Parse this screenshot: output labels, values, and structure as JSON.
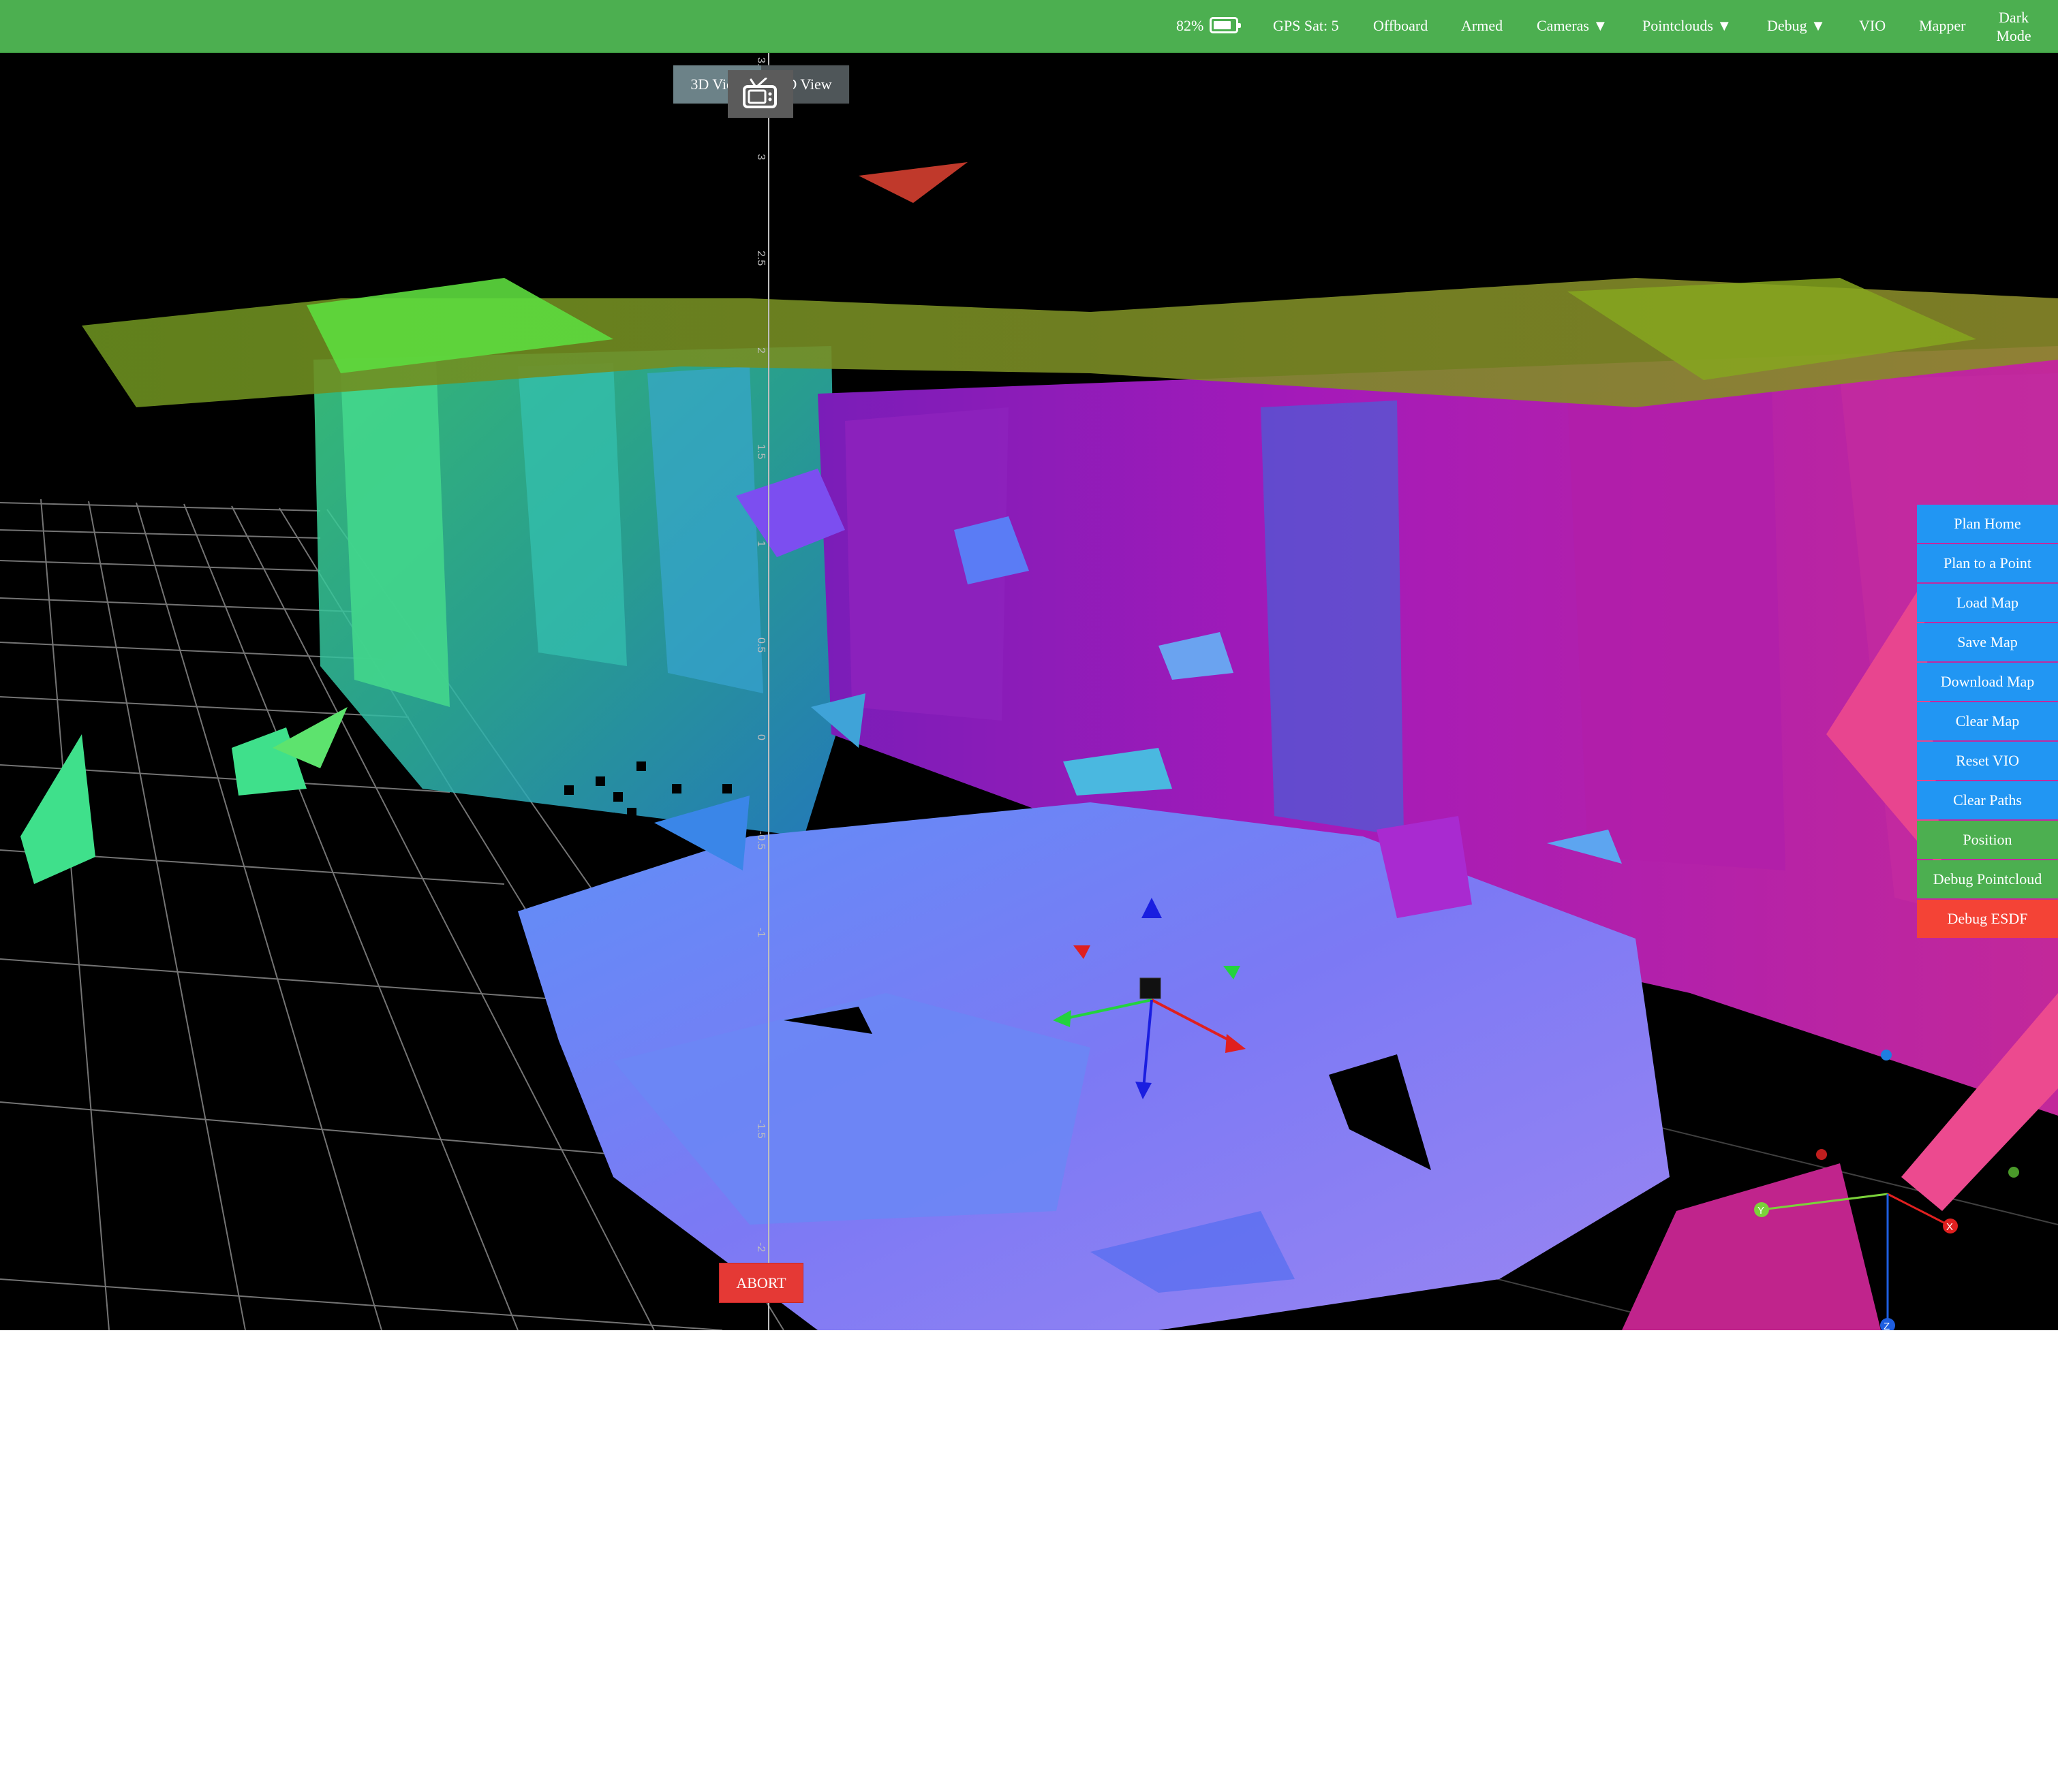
{
  "navbar": {
    "battery_percent": "82%",
    "battery_level": 0.82,
    "gps_sat": "GPS Sat: 5",
    "offboard": "Offboard",
    "armed": "Armed",
    "cameras": "Cameras ▼",
    "pointclouds": "Pointclouds ▼",
    "debug": "Debug ▼",
    "vio": "VIO",
    "mapper": "Mapper",
    "dark_mode": "Dark Mode",
    "colors": {
      "bar": "#4caf50",
      "text": "#ffffff"
    }
  },
  "view_toggle": {
    "left_label": "3D View",
    "right_label": "2D View",
    "tv_icon": "tv-icon"
  },
  "scene": {
    "axis_ticks": [
      "3.5",
      "3",
      "2.5",
      "2",
      "1.5",
      "1",
      "0.5",
      "0",
      "-0.5",
      "-1",
      "-1.5",
      "-2"
    ],
    "gizmo_labels": {
      "x": "X",
      "y": "Y",
      "z": "Z"
    },
    "colors": {
      "background": "#000000",
      "grid": "#8a8a8a"
    }
  },
  "abort": {
    "label": "ABORT",
    "color": "#e53935"
  },
  "actions": [
    {
      "label": "Plan Home",
      "color": "blue"
    },
    {
      "label": "Plan to a Point",
      "color": "blue"
    },
    {
      "label": "Load Map",
      "color": "blue"
    },
    {
      "label": "Save Map",
      "color": "blue"
    },
    {
      "label": "Download Map",
      "color": "blue"
    },
    {
      "label": "Clear Map",
      "color": "blue"
    },
    {
      "label": "Reset VIO",
      "color": "blue"
    },
    {
      "label": "Clear Paths",
      "color": "blue"
    },
    {
      "label": "Position",
      "color": "green"
    },
    {
      "label": "Debug Pointcloud",
      "color": "green"
    },
    {
      "label": "Debug ESDF",
      "color": "red"
    }
  ]
}
